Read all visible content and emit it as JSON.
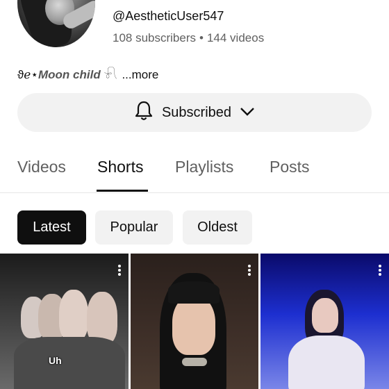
{
  "channel": {
    "handle": "@AestheticUser547",
    "subscribers": "108 subscribers",
    "separator": "•",
    "videos": "144 videos",
    "bio_prefix": "ϑℯ⋆",
    "bio": "Moon child",
    "bio_suffix": "𓍯",
    "more_label": "...more"
  },
  "subscribe_button": {
    "label": "Subscribed",
    "icon": "bell-icon"
  },
  "tabs": [
    {
      "label": "Videos",
      "active": false
    },
    {
      "label": "Shorts",
      "active": true
    },
    {
      "label": "Playlists",
      "active": false
    },
    {
      "label": "Posts",
      "active": false
    }
  ],
  "filters": [
    {
      "label": "Latest",
      "active": true
    },
    {
      "label": "Popular",
      "active": false
    },
    {
      "label": "Oldest",
      "active": false
    }
  ],
  "shorts": [
    {
      "caption": "Uh"
    },
    {
      "caption": ""
    },
    {
      "caption": ""
    }
  ],
  "colors": {
    "text": "#0f0f0f",
    "secondary": "#606060",
    "chip_bg": "#f2f2f2",
    "active_chip": "#0f0f0f"
  }
}
